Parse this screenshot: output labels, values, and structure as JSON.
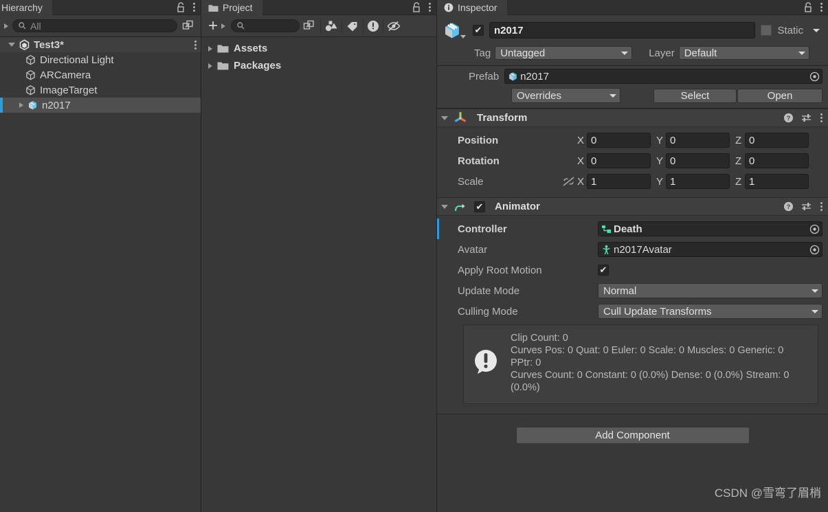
{
  "hierarchy": {
    "tab_label": "Hierarchy",
    "search": {
      "placeholder": "All"
    },
    "scene": {
      "label": "Test3*"
    },
    "items": [
      {
        "label": "Directional Light",
        "icon": "gameobject-icon"
      },
      {
        "label": "ARCamera",
        "icon": "gameobject-icon"
      },
      {
        "label": "ImageTarget",
        "icon": "gameobject-icon"
      },
      {
        "label": "n2017",
        "icon": "prefab-icon",
        "selected": true
      }
    ]
  },
  "project": {
    "tab_label": "Project",
    "search": {
      "placeholder": ""
    },
    "create_label": "+",
    "items": [
      {
        "label": "Assets"
      },
      {
        "label": "Packages"
      }
    ]
  },
  "inspector": {
    "tab_label": "Inspector",
    "gameobject": {
      "enabled": true,
      "name": "n2017",
      "static_label": "Static",
      "static_checked": false,
      "tag_label": "Tag",
      "tag_value": "Untagged",
      "layer_label": "Layer",
      "layer_value": "Default"
    },
    "prefab": {
      "label": "Prefab",
      "value": "n2017",
      "overrides_label": "Overrides",
      "select_label": "Select",
      "open_label": "Open"
    },
    "transform": {
      "title": "Transform",
      "rows": [
        {
          "name": "Position",
          "x": "0",
          "y": "0",
          "z": "0"
        },
        {
          "name": "Rotation",
          "x": "0",
          "y": "0",
          "z": "0"
        },
        {
          "name": "Scale",
          "x": "1",
          "y": "1",
          "z": "1"
        }
      ],
      "axis_x": "X",
      "axis_y": "Y",
      "axis_z": "Z"
    },
    "animator": {
      "title": "Animator",
      "enabled": true,
      "controller_label": "Controller",
      "controller_value": "Death",
      "avatar_label": "Avatar",
      "avatar_value": "n2017Avatar",
      "apply_root_motion_label": "Apply Root Motion",
      "apply_root_motion_checked": true,
      "update_mode_label": "Update Mode",
      "update_mode_value": "Normal",
      "culling_mode_label": "Culling Mode",
      "culling_mode_value": "Cull Update Transforms",
      "info": {
        "line1": "Clip Count: 0",
        "line2": "Curves Pos: 0 Quat: 0 Euler: 0 Scale: 0 Muscles: 0 Generic: 0",
        "line3": "PPtr: 0",
        "line4": "Curves Count: 0 Constant: 0 (0.0%) Dense: 0 (0.0%) Stream: 0",
        "line5": "(0.0%)"
      }
    },
    "add_component_label": "Add Component"
  },
  "watermark": "CSDN @雪弯了眉梢",
  "colors": {
    "accent_blue": "#2c9ede",
    "panel_bg": "#383838",
    "header_bg": "#3c3c3c",
    "field_bg": "#282828",
    "teal": "#47e0b0"
  }
}
